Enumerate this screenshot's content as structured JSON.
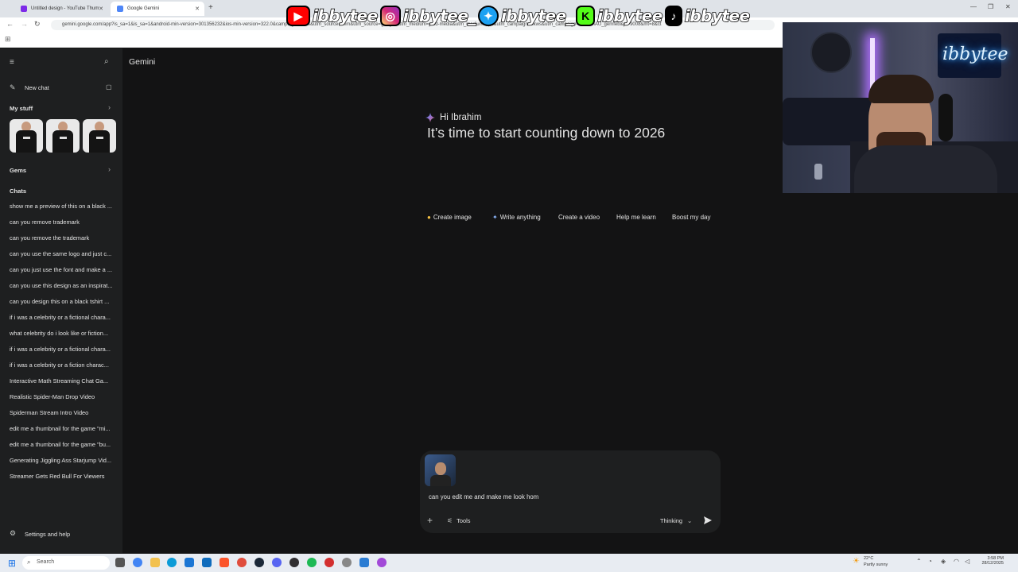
{
  "browser": {
    "tabs": [
      {
        "label": "Untitled design - YouTube Thum",
        "icon": "canva-icon",
        "active": false
      },
      {
        "label": "Google Gemini",
        "icon": "gemini-icon",
        "active": true
      }
    ],
    "url": "gemini.google.com/app?is_sa=1&is_sa=1&android-min-version=301356232&ios-min-version=322.0&campaign=bkws&utm_source=sem&utm_source=google&utm_medium=paid-media&utm_medium=cpc&utm_campaign=bkws&utm_campaign=2024enAU_gemfeb&pt=9008&mt=8&ct"
  },
  "socials": [
    {
      "platform": "youtube-icon",
      "handle": "ibbytee",
      "color": "#ff0000"
    },
    {
      "platform": "instagram-icon",
      "handle": "ibbytee_",
      "color": "#d62976"
    },
    {
      "platform": "twitter-icon",
      "handle": "ibbytee_",
      "color": "#1da1f2"
    },
    {
      "platform": "kick-icon",
      "handle": "ibbytee",
      "color": "#53fc18"
    },
    {
      "platform": "tiktok-icon",
      "handle": "ibbytee",
      "color": "#000000"
    }
  ],
  "webcam": {
    "neon_sign": "ibbytee"
  },
  "gemini": {
    "app_title": "Gemini",
    "sidebar": {
      "new_chat": "New chat",
      "my_stuff": "My stuff",
      "gems": "Gems",
      "chats_header": "Chats",
      "chats": [
        "show me a preview of this on a black ...",
        "can you remove trademark",
        "can you remove the trademark",
        "can you use the same logo and just c...",
        "can you just use the font and make a ...",
        "can you use this design as an inspirat...",
        "can you design this on a black tshirt ...",
        "if i was a celebrity or a fictional chara...",
        "what celebrity do i look like or fiction...",
        "if i was a celebrity or a fictional chara...",
        "if i was a celebrity or a fiction charac...",
        "Interactive Math Streaming Chat Ga...",
        "Realistic Spider-Man Drop Video",
        "Spiderman Stream Intro Video",
        "edit me a thumbnail for the game \"mi...",
        "edit me a thumbnail for the game \"bu...",
        "Generating Jiggling Ass Starjump Vid...",
        "Streamer Gets Red Bull For Viewers"
      ],
      "settings": "Settings and help"
    },
    "greeting": "Hi Ibrahim",
    "headline": "It’s time to start counting down to 2026",
    "chips": [
      {
        "label": "Create image",
        "icon": "banana-icon"
      },
      {
        "label": "Write anything",
        "icon": "sparkle-icon"
      },
      {
        "label": "Create a video",
        "icon": ""
      },
      {
        "label": "Help me learn",
        "icon": ""
      },
      {
        "label": "Boost my day",
        "icon": ""
      }
    ],
    "composer": {
      "text": "can you edit me and make me look hom",
      "tools": "Tools",
      "mode": "Thinking"
    }
  },
  "taskbar": {
    "search": "Search",
    "weather_temp": "22°C",
    "weather_desc": "Partly sunny",
    "time": "3:58 PM",
    "date": "28/12/2025"
  }
}
